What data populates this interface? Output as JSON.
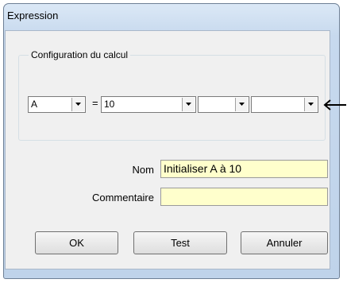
{
  "window": {
    "title": "Expression"
  },
  "group": {
    "legend": "Configuration du calcul"
  },
  "calculation": {
    "operand_left": "A",
    "equals_sign": "=",
    "operand_right_1": "10",
    "operand_right_2": "",
    "operand_right_3": ""
  },
  "form": {
    "name_label": "Nom",
    "name_value": "Initialiser A à 10",
    "comment_label": "Commentaire",
    "comment_value": ""
  },
  "buttons": {
    "ok": "OK",
    "test": "Test",
    "cancel": "Annuler"
  },
  "colors": {
    "field_background": "#ffffcc",
    "dialog_background": "#f0f0f0"
  },
  "icons": {
    "annotation": "arrow-left-icon",
    "dropdown": "chevron-down-icon"
  }
}
